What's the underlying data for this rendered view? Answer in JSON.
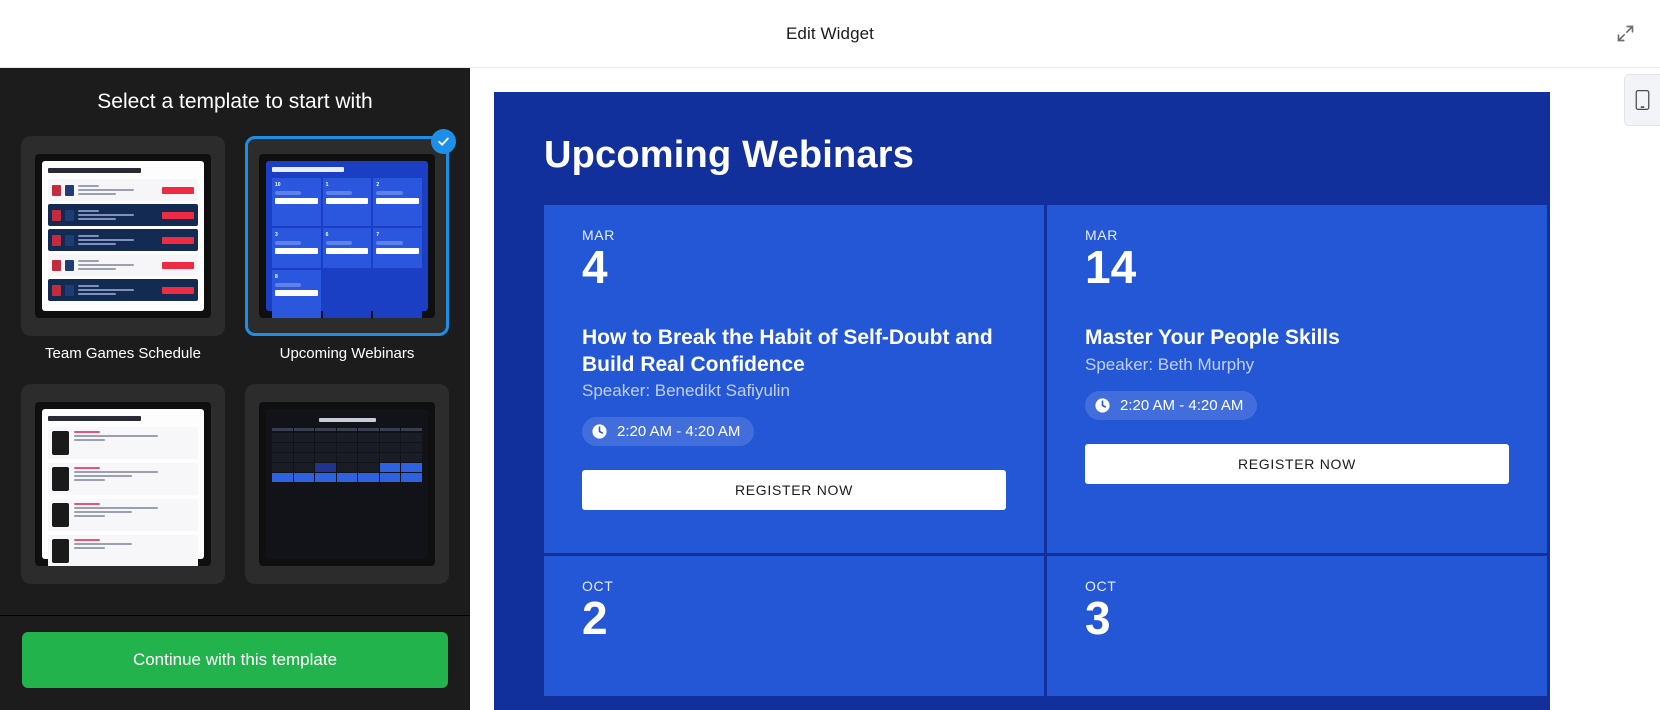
{
  "header": {
    "title": "Edit Widget",
    "expand_icon": "expand-arrows-icon"
  },
  "sidebar": {
    "heading": "Select a template to start with",
    "continue_label": "Continue with this template",
    "check_icon": "check-icon",
    "templates": [
      {
        "label": "Team Games Schedule",
        "selected": false,
        "preview_title": "Cleveland Indians Nearest Games"
      },
      {
        "label": "Upcoming Webinars",
        "selected": true,
        "preview_title": "Upcoming Webinars"
      },
      {
        "label": "",
        "selected": false,
        "preview_title": "Upcoming Featured Events University"
      },
      {
        "label": "",
        "selected": false,
        "preview_title": "Movie Show Schedule"
      }
    ]
  },
  "preview": {
    "mobile_toggle_icon": "mobile-phone-icon",
    "widget": {
      "title": "Upcoming Webinars",
      "accent_bg": "#12309c",
      "card_bg": "#2357d6",
      "cards": [
        {
          "month": "MAR",
          "day": "4",
          "title": "How to Break the Habit of Self-Doubt and Build Real Confidence",
          "speaker": "Speaker: Benedikt Safiyulin",
          "time": "2:20 AM - 4:20 AM",
          "time_icon": "clock-icon",
          "register_label": "REGISTER NOW"
        },
        {
          "month": "MAR",
          "day": "14",
          "title": "Master Your People Skills",
          "speaker": "Speaker: Beth Murphy",
          "time": "2:20 AM - 4:20 AM",
          "time_icon": "clock-icon",
          "register_label": "REGISTER NOW"
        },
        {
          "month": "OCT",
          "day": "2",
          "title": "",
          "speaker": "",
          "time": "",
          "time_icon": "clock-icon",
          "register_label": ""
        },
        {
          "month": "OCT",
          "day": "3",
          "title": "",
          "speaker": "",
          "time": "",
          "time_icon": "clock-icon",
          "register_label": ""
        }
      ]
    }
  },
  "colors": {
    "accent_blue": "#1e8fe8",
    "widget_blue": "#12309c",
    "card_blue": "#2357d6",
    "continue_green": "#22b34c",
    "sidebar_dark": "#1c1c1c"
  }
}
